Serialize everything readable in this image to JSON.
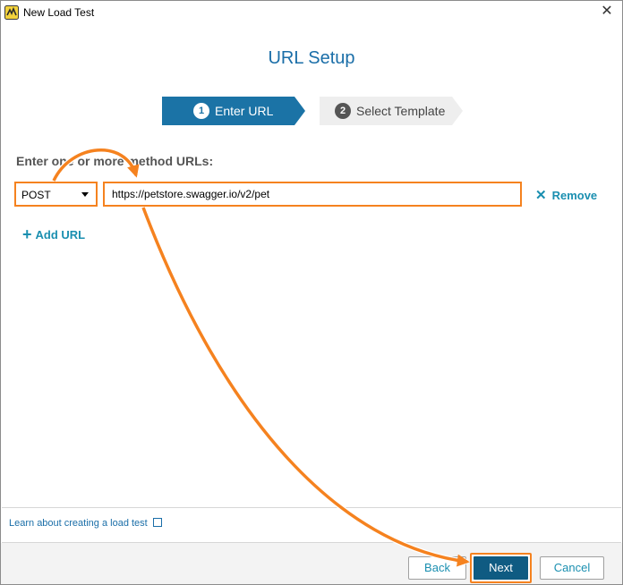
{
  "window": {
    "title": "New Load Test",
    "close_glyph": "✕",
    "icon": "loadninja-app-icon"
  },
  "heading": "URL Setup",
  "steps": [
    {
      "number": "1",
      "label": "Enter URL",
      "active": true
    },
    {
      "number": "2",
      "label": "Select Template",
      "active": false
    }
  ],
  "prompt": "Enter one or more method URLs:",
  "url_row": {
    "method": "POST",
    "url": "https://petstore.swagger.io/v2/pet",
    "remove_label": "Remove",
    "remove_glyph": "✕"
  },
  "add_url": {
    "label": "Add URL",
    "glyph": "+"
  },
  "learn_link": "Learn about creating a load test",
  "buttons": {
    "back": "Back",
    "next": "Next",
    "cancel": "Cancel"
  },
  "colors": {
    "accent": "#1a6ea8",
    "active_step": "#1b73a6",
    "highlight": "#f5821f",
    "primary_button": "#0f5b82",
    "link": "#1a8fb0"
  }
}
